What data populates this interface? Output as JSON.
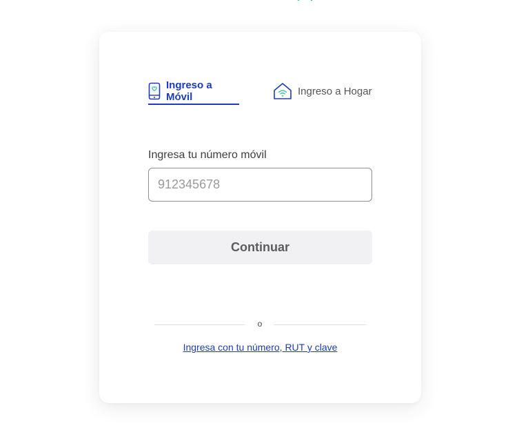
{
  "tabs": {
    "mobile_label": "Ingreso a Móvil",
    "home_label": "Ingreso a Hogar"
  },
  "form": {
    "field_label": "Ingresa tu número móvil",
    "phone_placeholder": "912345678",
    "phone_value": "",
    "continue_label": "Continuar"
  },
  "divider": {
    "text": "o"
  },
  "alt_login": {
    "link_label": "Ingresa con tu número, RUT y clave"
  },
  "colors": {
    "accent": "#1b3bc0",
    "wifi": "#2ec4a6",
    "button_bg": "#f1f1f3"
  },
  "icons": {
    "mobile_tab": "smartphone-icon",
    "home_tab": "home-wifi-icon"
  }
}
